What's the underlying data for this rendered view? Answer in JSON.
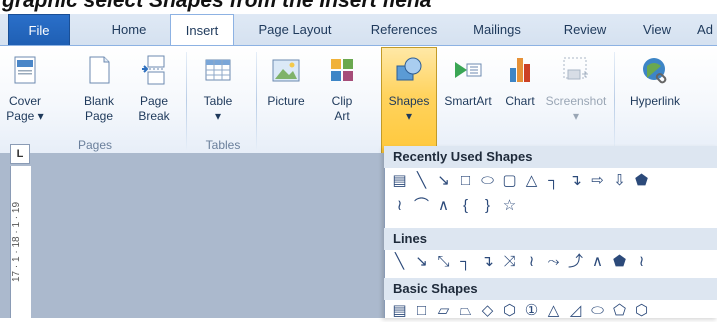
{
  "caption": "graphic select Shapes from the Insert fiena",
  "tabs": [
    {
      "label": "File"
    },
    {
      "label": "Home"
    },
    {
      "label": "Insert"
    },
    {
      "label": "Page Layout"
    },
    {
      "label": "References"
    },
    {
      "label": "Mailings"
    },
    {
      "label": "Review"
    },
    {
      "label": "View"
    },
    {
      "label": "Ad"
    }
  ],
  "ribbon": {
    "cover_page": {
      "line1": "Cover",
      "line2": "Page ▾"
    },
    "blank_page": {
      "line1": "Blank",
      "line2": "Page"
    },
    "page_break": {
      "line1": "Page",
      "line2": "Break"
    },
    "table": {
      "line1": "Table",
      "line2": "▾"
    },
    "picture": {
      "line1": "Picture"
    },
    "clip_art": {
      "line1": "Clip",
      "line2": "Art"
    },
    "shapes": {
      "line1": "Shapes",
      "line2": "▾"
    },
    "smartart": {
      "line1": "SmartArt"
    },
    "chart": {
      "line1": "Chart"
    },
    "screenshot": {
      "line1": "Screenshot",
      "line2": "▾"
    },
    "hyperlink": {
      "line1": "Hyperlink"
    },
    "groups": {
      "pages": "Pages",
      "tables": "Tables"
    }
  },
  "ruler": {
    "tab_selector": "L",
    "marks": "17 · 1 · 18 · 1 · 19"
  },
  "dropdown": {
    "recently_used": {
      "title": "Recently Used Shapes",
      "row1": [
        "▤",
        "╲",
        "↘",
        "□",
        "⬭",
        "▢",
        "△",
        "┐",
        "↴",
        "⇨",
        "⇩",
        "⬟"
      ],
      "row2": [
        "≀",
        "⌒",
        "∧",
        "{",
        "}",
        "☆"
      ]
    },
    "lines": {
      "title": "Lines",
      "row1": [
        "╲",
        "↘",
        "⤡",
        "┐",
        "↴",
        "⤨",
        "≀",
        "⤳",
        "⤴",
        "∧",
        "⬟",
        "≀"
      ]
    },
    "basic_shapes": {
      "title": "Basic Shapes",
      "row1": [
        "▤",
        "□",
        "▱",
        "⏢",
        "◇",
        "⬡",
        "①",
        "△",
        "◿",
        "⬭",
        "⬠",
        "⬡"
      ]
    }
  },
  "colors": {
    "accent": "#ffc83a",
    "file_tab": "#2a6fc9",
    "doc_bg": "#abb9cd"
  }
}
